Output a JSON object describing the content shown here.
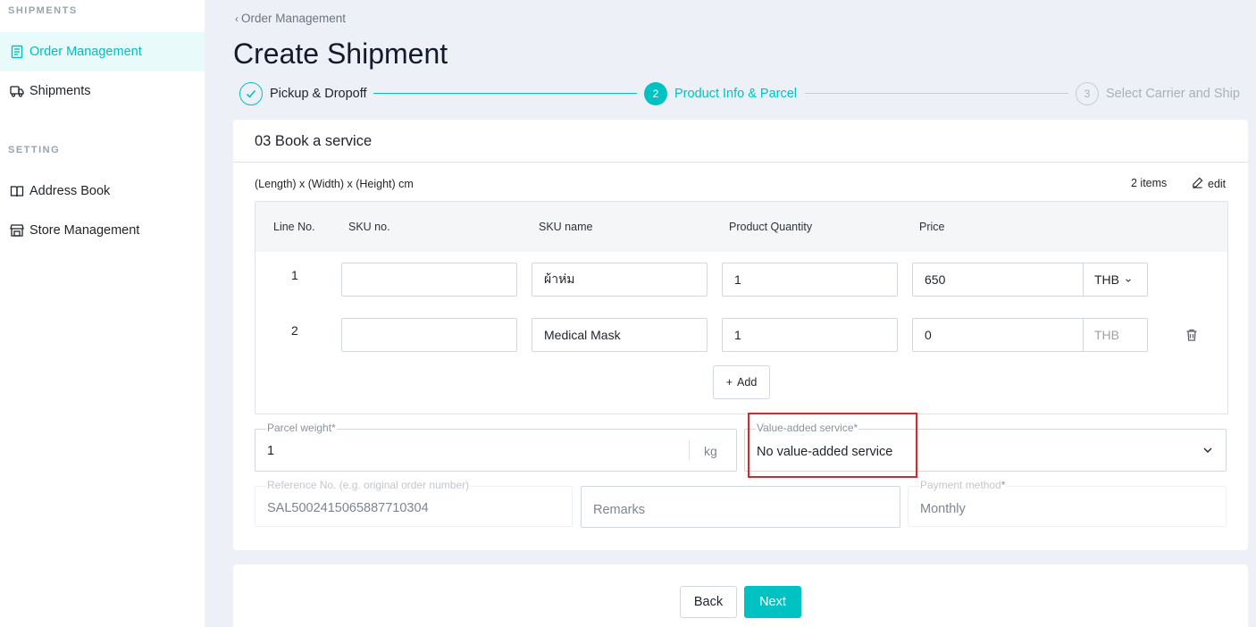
{
  "sidebar": {
    "section_shipments": "SHIPMENTS",
    "section_setting": "SETTING",
    "items": [
      {
        "label": "Order Management",
        "icon": "document-list-icon",
        "active": true
      },
      {
        "label": "Shipments",
        "icon": "truck-icon",
        "active": false
      },
      {
        "label": "Address Book",
        "icon": "book-icon",
        "active": false
      },
      {
        "label": "Store Management",
        "icon": "store-icon",
        "active": false
      }
    ]
  },
  "header": {
    "breadcrumb": "Order Management",
    "title": "Create Shipment"
  },
  "steps": [
    {
      "label": "Pickup & Dropoff",
      "marker": "✓",
      "state": "done"
    },
    {
      "label": "Product Info & Parcel",
      "marker": "2",
      "state": "active"
    },
    {
      "label": "Select Carrier and Ship",
      "marker": "3",
      "state": "pending"
    }
  ],
  "card": {
    "title": "03 Book a service",
    "dims_label": "(Length) x (Width) x (Height) cm",
    "items_count": "2 items",
    "edit_label": "edit",
    "columns": [
      "Line No.",
      "SKU no.",
      "SKU name",
      "Product Quantity",
      "Price"
    ],
    "rows": [
      {
        "line": "1",
        "sku_no": "",
        "sku_name": "ผ้าห่ม",
        "quantity": "1",
        "price": "650",
        "currency": "THB",
        "currency_dropdown": true
      },
      {
        "line": "2",
        "sku_no": "",
        "sku_name": "Medical Mask",
        "quantity": "1",
        "price": "0",
        "currency": "THB",
        "currency_dropdown": false
      }
    ],
    "add_label": "Add",
    "parcel_weight": {
      "label": "Parcel weight",
      "value": "1",
      "unit": "kg"
    },
    "value_added": {
      "label": "Value-added service",
      "value": "No value-added service"
    },
    "reference": {
      "label": "Reference No. (e.g. original order number)",
      "value": "SAL5002415065887710304"
    },
    "remarks": {
      "placeholder": "Remarks"
    },
    "payment": {
      "label": "Payment method",
      "value": "Monthly"
    },
    "required_mark": "*"
  },
  "footer": {
    "back_label": "Back",
    "next_label": "Next"
  },
  "colors": {
    "accent": "#00c2c2",
    "highlight": "#e0242b"
  }
}
